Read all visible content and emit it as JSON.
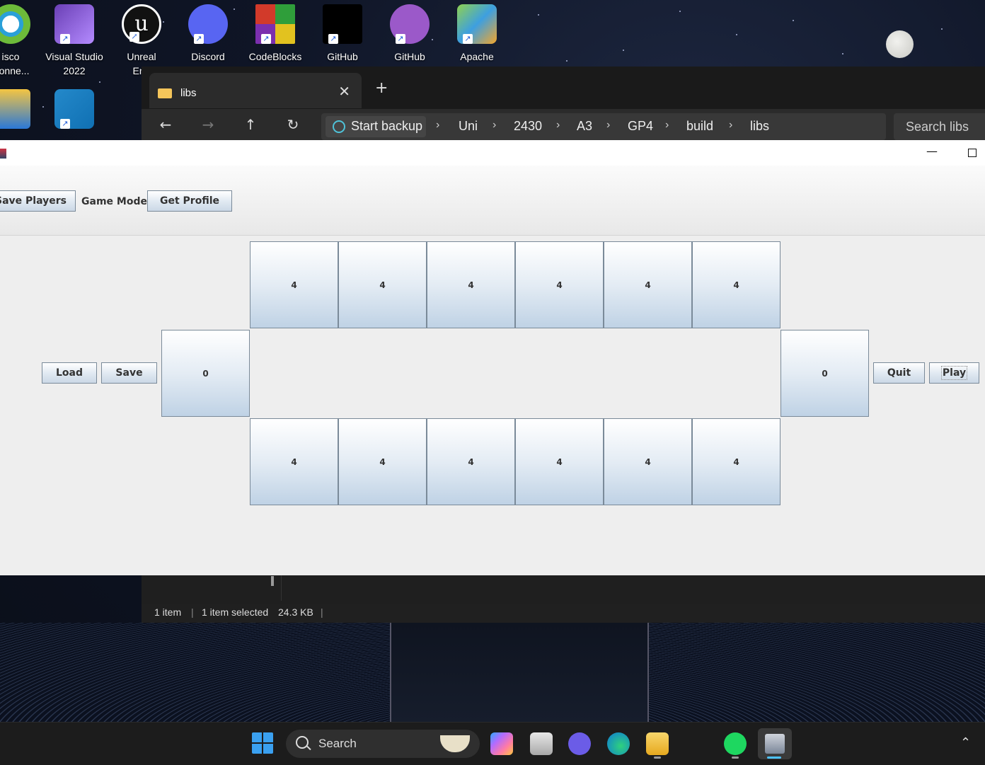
{
  "desktop": {
    "icons": [
      {
        "label_line1": "isco",
        "label_line2": "Conne...",
        "color": "#2aa0d8"
      },
      {
        "label_line1": "Visual Studio",
        "label_line2": "2022",
        "color": "#8f5fd7"
      },
      {
        "label_line1": "Unreal",
        "label_line2": "Eng",
        "color": "#111111"
      },
      {
        "label_line1": "Discord",
        "label_line2": "",
        "color": "#5865f2"
      },
      {
        "label_line1": "CodeBlocks",
        "label_line2": "",
        "color": "#d23a2a"
      },
      {
        "label_line1": "GitHub",
        "label_line2": "",
        "color": "#000000"
      },
      {
        "label_line1": "GitHub",
        "label_line2": "",
        "color": "#9b59c9"
      },
      {
        "label_line1": "Apache",
        "label_line2": "",
        "color": "#3d9fe0"
      }
    ]
  },
  "explorer": {
    "tab_title": "libs",
    "address": {
      "backup_label": "Start backup",
      "segments": [
        "Uni",
        "2430",
        "A3",
        "GP4",
        "build",
        "libs"
      ]
    },
    "search_placeholder": "Search libs",
    "status": {
      "items": "1 item",
      "selected": "1 item selected",
      "size": "24.3 KB"
    }
  },
  "game": {
    "toolbar": {
      "save_players": "Save Players",
      "game_mode": "Game Mode",
      "get_profile": "Get Profile"
    },
    "buttons": {
      "load": "Load",
      "save": "Save",
      "quit": "Quit",
      "play": "Play"
    },
    "board": {
      "top_pits": [
        "4",
        "4",
        "4",
        "4",
        "4",
        "4"
      ],
      "bottom_pits": [
        "4",
        "4",
        "4",
        "4",
        "4",
        "4"
      ],
      "left_store": "0",
      "right_store": "0"
    }
  },
  "taskbar": {
    "search_label": "Search"
  }
}
